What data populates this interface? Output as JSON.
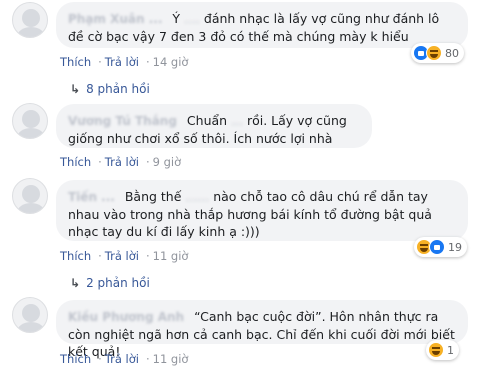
{
  "comments": [
    {
      "name": "Phạm Xuân ...",
      "text_before": "Ý ",
      "text_blur": "....",
      "text_after": " đánh nhạc là lấy vợ cũng như đánh lô đề cờ bạc vậy 7 đen 3 đỏ có thế mà chúng mày k hiểu",
      "reaction_count": "80",
      "like": "Thích",
      "reply": "Trả lời",
      "time": "14 giờ",
      "replies_label": "8 phản hồi"
    },
    {
      "name": "Vương Tú Thắng",
      "text_before": "Chuẩn ",
      "text_blur": "...",
      "text_after": " rồi. Lấy vợ cũng giống như chơi xổ số thôi. Ích nước lợi nhà",
      "like": "Thích",
      "reply": "Trả lời",
      "time": "9 giờ"
    },
    {
      "name": "Tiến ...",
      "text_before": "Bằng thế ",
      "text_blur": "......",
      "text_after": " nào chỗ tao cô dâu chú rể dẫn tay nhau vào trong nhà thắp hương bái kính tổ đường bật quả nhạc tay du kí đi lấy kinh ạ :)))",
      "reaction_count": "19",
      "like": "Thích",
      "reply": "Trả lời",
      "time": "11 giờ",
      "replies_label": "2 phản hồi"
    },
    {
      "name": "Kiều Phương Anh",
      "text_before": "“Canh bạc cuộc đời”. Hôn nhân thực ra còn nghiệt ngã hơn cả canh bạc. Chỉ đến khi cuối đời mới biết kết quả!",
      "reaction_count": "1",
      "like": "Thích",
      "reply": "Trả lời",
      "time": "11 giờ"
    }
  ],
  "colors": {
    "link": "#385898",
    "bubble": "#f2f3f5",
    "meta": "#90949c"
  }
}
